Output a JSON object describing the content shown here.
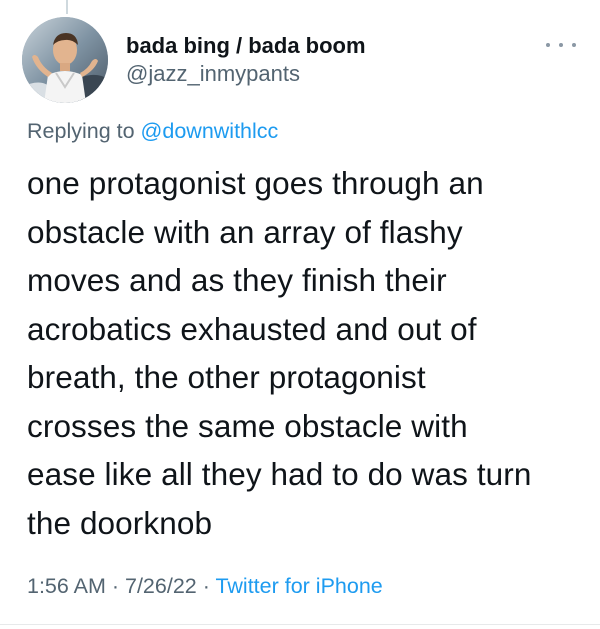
{
  "tweet": {
    "author": {
      "display_name": "bada bing / bada boom",
      "handle": "@jazz_inmypants",
      "avatar_icon": "profile-avatar"
    },
    "reply_context": {
      "prefix": "Replying to ",
      "mention": "@downwithlcc"
    },
    "text_lines": [
      "one protagonist goes through an",
      "obstacle with an array of flashy",
      "moves and as they finish their",
      "acrobatics exhausted and out of",
      "breath, the other protagonist",
      "crosses the same obstacle with",
      "ease like all they had to do was turn",
      "the doorknob"
    ],
    "meta": {
      "time": "1:56 AM",
      "separator": " · ",
      "date": "7/26/22",
      "source": "Twitter for iPhone"
    },
    "more_icon": "more-horizontal-icon"
  },
  "colors": {
    "text_primary": "#0f1419",
    "text_secondary": "#536471",
    "link": "#1d9bf0",
    "divider": "#e7e9ea"
  }
}
